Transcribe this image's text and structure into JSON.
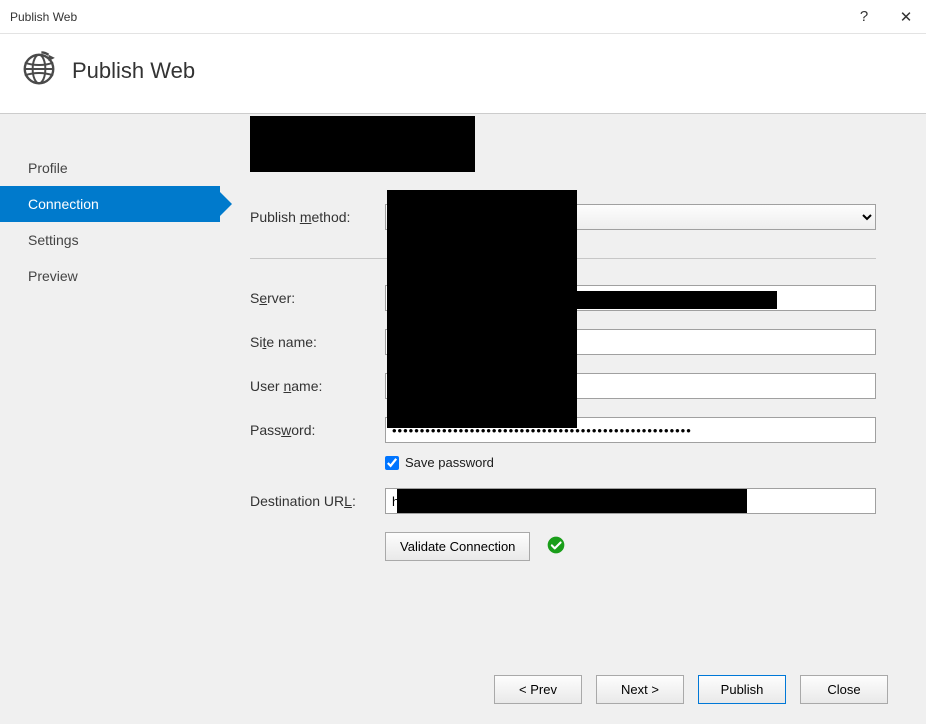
{
  "window": {
    "title": "Publish Web",
    "help_symbol": "?",
    "close_symbol": "✕"
  },
  "header": {
    "title": "Publish Web"
  },
  "sidebar": {
    "items": [
      {
        "label": "Profile",
        "active": false
      },
      {
        "label": "Connection",
        "active": true
      },
      {
        "label": "Settings",
        "active": false
      },
      {
        "label": "Preview",
        "active": false
      }
    ]
  },
  "form": {
    "publish_method_label_pre": "Publish ",
    "publish_method_label_ul": "m",
    "publish_method_label_post": "ethod:",
    "publish_method_value": "",
    "server_label_pre": "S",
    "server_label_ul": "e",
    "server_label_post": "rver:",
    "server_value": "",
    "sitename_label_pre": "Si",
    "sitename_label_ul": "t",
    "sitename_label_post": "e name:",
    "sitename_value": "",
    "username_label_pre": "User ",
    "username_label_ul": "n",
    "username_label_post": "ame:",
    "username_value": "",
    "password_label_pre": "Pass",
    "password_label_ul": "w",
    "password_label_post": "ord:",
    "password_value": "••••••••••••••••••••••••••••••••••••••••••••••••••••••",
    "save_password_pre": "S",
    "save_password_ul": "a",
    "save_password_post": "ve password",
    "save_password_checked": true,
    "desturl_label_pre": "Destination UR",
    "desturl_label_ul": "L",
    "desturl_label_post": ":",
    "desturl_value": "h",
    "validate_pre": "",
    "validate_ul": "V",
    "validate_post": "alidate Connection"
  },
  "footer": {
    "prev_pre": "< P",
    "prev_ul": "r",
    "prev_post": "ev",
    "next_pre": "Ne",
    "next_ul": "x",
    "next_post": "t >",
    "publish_pre": "P",
    "publish_ul": "u",
    "publish_post": "blish",
    "close_pre": "C",
    "close_ul": "l",
    "close_post": "ose"
  }
}
